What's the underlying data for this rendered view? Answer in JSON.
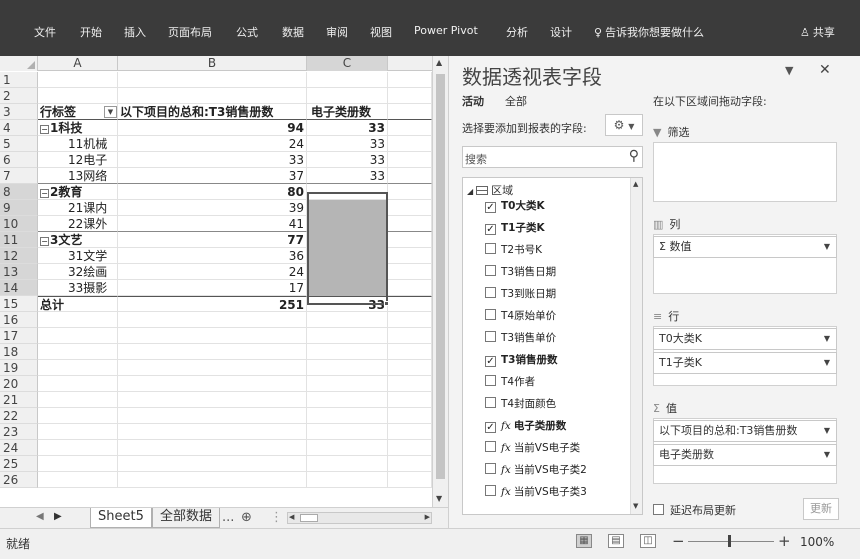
{
  "ribbon": {
    "tabs": [
      "文件",
      "开始",
      "插入",
      "页面布局",
      "公式",
      "数据",
      "审阅",
      "视图",
      "Power Pivot",
      "分析",
      "设计"
    ],
    "tell_me": "告诉我你想要做什么",
    "share": "共享"
  },
  "sheet": {
    "columns": [
      "A",
      "B",
      "C"
    ],
    "rows": [
      {
        "num": "1",
        "a": "",
        "b": "",
        "c": ""
      },
      {
        "num": "2",
        "a": "",
        "b": "",
        "c": ""
      },
      {
        "num": "3",
        "a": "行标签",
        "b": "以下项目的总和:T3销售册数",
        "c": "电子类册数"
      },
      {
        "num": "4",
        "a": "1科技",
        "b": "94",
        "c": "33"
      },
      {
        "num": "5",
        "a": "11机械",
        "b": "24",
        "c": "33"
      },
      {
        "num": "6",
        "a": "12电子",
        "b": "33",
        "c": "33"
      },
      {
        "num": "7",
        "a": "13网络",
        "b": "37",
        "c": "33"
      },
      {
        "num": "8",
        "a": "2教育",
        "b": "80",
        "c": ""
      },
      {
        "num": "9",
        "a": "21课内",
        "b": "39",
        "c": ""
      },
      {
        "num": "10",
        "a": "22课外",
        "b": "41",
        "c": ""
      },
      {
        "num": "11",
        "a": "3文艺",
        "b": "77",
        "c": ""
      },
      {
        "num": "12",
        "a": "31文学",
        "b": "36",
        "c": ""
      },
      {
        "num": "13",
        "a": "32绘画",
        "b": "24",
        "c": ""
      },
      {
        "num": "14",
        "a": "33摄影",
        "b": "17",
        "c": ""
      },
      {
        "num": "15",
        "a": "总计",
        "b": "251",
        "c": "33"
      },
      {
        "num": "16",
        "a": "",
        "b": "",
        "c": ""
      },
      {
        "num": "17",
        "a": "",
        "b": "",
        "c": ""
      },
      {
        "num": "18",
        "a": "",
        "b": "",
        "c": ""
      },
      {
        "num": "19",
        "a": "",
        "b": "",
        "c": ""
      },
      {
        "num": "20",
        "a": "",
        "b": "",
        "c": ""
      },
      {
        "num": "21",
        "a": "",
        "b": "",
        "c": ""
      },
      {
        "num": "22",
        "a": "",
        "b": "",
        "c": ""
      },
      {
        "num": "23",
        "a": "",
        "b": "",
        "c": ""
      },
      {
        "num": "24",
        "a": "",
        "b": "",
        "c": ""
      },
      {
        "num": "25",
        "a": "",
        "b": "",
        "c": ""
      },
      {
        "num": "26",
        "a": "",
        "b": "",
        "c": ""
      }
    ],
    "tabs": [
      "Sheet5",
      "全部数据"
    ],
    "tabs_more": "..."
  },
  "status": {
    "ready": "就绪",
    "zoom": "100%"
  },
  "pane": {
    "title": "数据透视表字段",
    "tabs": [
      "活动",
      "全部"
    ],
    "drag_hint": "在以下区域间拖动字段:",
    "choose_label": "选择要添加到报表的字段:",
    "search_placeholder": "搜索",
    "root": "区域",
    "fields": [
      {
        "label": "T0大类K",
        "checked": true,
        "calc": false
      },
      {
        "label": "T1子类K",
        "checked": true,
        "calc": false
      },
      {
        "label": "T2书号K",
        "checked": false,
        "calc": false
      },
      {
        "label": "T3销售日期",
        "checked": false,
        "calc": false
      },
      {
        "label": "T3到账日期",
        "checked": false,
        "calc": false
      },
      {
        "label": "T4原始单价",
        "checked": false,
        "calc": false
      },
      {
        "label": "T3销售单价",
        "checked": false,
        "calc": false
      },
      {
        "label": "T3销售册数",
        "checked": true,
        "calc": false
      },
      {
        "label": "T4作者",
        "checked": false,
        "calc": false
      },
      {
        "label": "T4封面颜色",
        "checked": false,
        "calc": false
      },
      {
        "label": "电子类册数",
        "checked": true,
        "calc": true
      },
      {
        "label": "当前VS电子类",
        "checked": false,
        "calc": true
      },
      {
        "label": "当前VS电子类2",
        "checked": false,
        "calc": true
      },
      {
        "label": "当前VS电子类3",
        "checked": false,
        "calc": true
      }
    ],
    "zones": {
      "filter_label": "筛选",
      "columns_label": "列",
      "columns_items": [
        "Σ 数值"
      ],
      "rows_label": "行",
      "rows_items": [
        "T0大类K",
        "T1子类K"
      ],
      "values_label": "值",
      "values_items": [
        "以下项目的总和:T3销售册数",
        "电子类册数"
      ]
    },
    "defer_label": "延迟布局更新",
    "update_label": "更新"
  }
}
